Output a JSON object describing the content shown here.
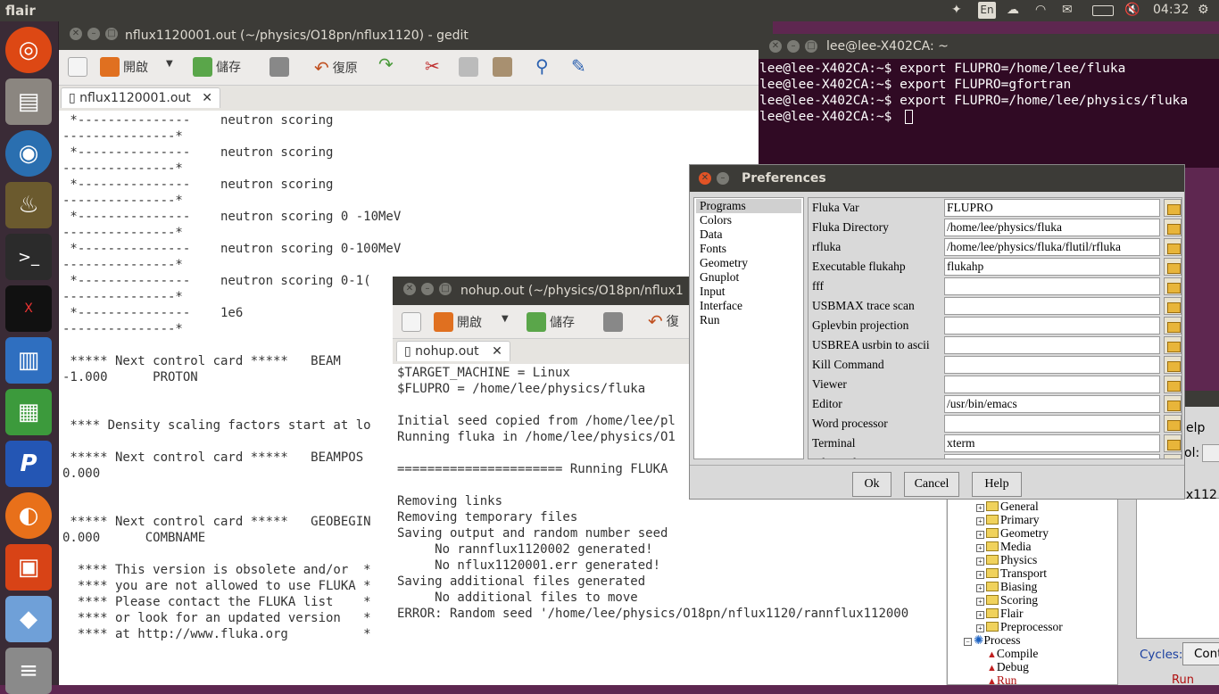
{
  "topbar": {
    "app_name": "flair",
    "lang": "En",
    "clock": "04:32"
  },
  "launcher": {
    "items": [
      "ubuntu-icon",
      "files-icon",
      "chromium-icon",
      "flair-icon",
      "terminal-icon",
      "xterm-icon",
      "writer-icon",
      "calc-icon",
      "p-app-icon",
      "firefox-icon",
      "installer-icon",
      "package-icon",
      "stack-icon"
    ]
  },
  "gedit1": {
    "title": "nflux1120001.out (~/physics/O18pn/nflux1120) - gedit",
    "toolbar": {
      "open": "開啟",
      "save": "儲存",
      "undo": "復原"
    },
    "tab": "nflux1120001.out",
    "lines": [
      " *---------------    neutron scoring",
      "---------------*",
      " *---------------    neutron scoring",
      "---------------*",
      " *---------------    neutron scoring",
      "---------------*",
      " *---------------    neutron scoring 0 -10MeV",
      "---------------*",
      " *---------------    neutron scoring 0-100MeV",
      "---------------*",
      " *---------------    neutron scoring 0-1(",
      "---------------*",
      " *---------------    1e6",
      "---------------*",
      "",
      " ***** Next control card *****   BEAM",
      "-1.000      PROTON",
      "",
      "",
      " **** Density scaling factors start at lo",
      "",
      " ***** Next control card *****   BEAMPOS",
      "0.000",
      "",
      "",
      " ***** Next control card *****   GEOBEGIN",
      "0.000      COMBNAME",
      "",
      "  **** This version is obsolete and/or  *",
      "  **** you are not allowed to use FLUKA *",
      "  **** Please contact the FLUKA list    *",
      "  **** or look for an updated version   *",
      "  **** at http://www.fluka.org          *"
    ]
  },
  "terminal": {
    "title": "lee@lee-X402CA: ~",
    "lines": [
      "lee@lee-X402CA:~$ export FLUPRO=/home/lee/fluka",
      "lee@lee-X402CA:~$ export FLUPRO=gfortran",
      "lee@lee-X402CA:~$ export FLUPRO=/home/lee/physics/fluka",
      "lee@lee-X402CA:~$ "
    ]
  },
  "gedit2": {
    "title": "nohup.out (~/physics/O18pn/nflux1",
    "toolbar": {
      "open": "開啟",
      "save": "儲存",
      "undo": "復"
    },
    "tab": "nohup.out",
    "lines": [
      "$TARGET_MACHINE = Linux",
      "$FLUPRO = /home/lee/physics/fluka",
      "",
      "Initial seed copied from /home/lee/pl",
      "Running fluka in /home/lee/physics/O1",
      "",
      "====================== Running FLUKA",
      "",
      "Removing links",
      "Removing temporary files",
      "Saving output and random number seed",
      "     No rannflux1120002 generated!",
      "     No nflux1120001.err generated!",
      "Saving additional files generated",
      "     No additional files to move",
      "ERROR: Random seed '/home/lee/physics/O18pn/nflux1120/rannflux112000"
    ]
  },
  "prefs": {
    "title": "Preferences",
    "categories": [
      "Programs",
      "Colors",
      "Data",
      "Fonts",
      "Geometry",
      "Gnuplot",
      "Input",
      "Interface",
      "Run"
    ],
    "rows": [
      {
        "label": "Fluka Var",
        "value": "FLUPRO"
      },
      {
        "label": "Fluka Directory",
        "value": "/home/lee/physics/fluka"
      },
      {
        "label": "rfluka",
        "value": "/home/lee/physics/fluka/flutil/rfluka"
      },
      {
        "label": "Executable flukahp",
        "value": "flukahp"
      },
      {
        "label": "fff",
        "value": ""
      },
      {
        "label": "USBMAX trace scan",
        "value": ""
      },
      {
        "label": "Gplevbin projection",
        "value": ""
      },
      {
        "label": "USBREA usrbin to ascii",
        "value": ""
      },
      {
        "label": "Kill Command",
        "value": ""
      },
      {
        "label": "Viewer",
        "value": ""
      },
      {
        "label": "Editor",
        "value": "/usr/bin/emacs"
      },
      {
        "label": "Word processor",
        "value": ""
      },
      {
        "label": "Terminal",
        "value": "xterm"
      },
      {
        "label": "File Explorer",
        "value": ""
      }
    ],
    "buttons": {
      "ok": "Ok",
      "cancel": "Cancel",
      "help": "Help"
    }
  },
  "flair": {
    "tree": [
      {
        "label": "General",
        "type": "folder"
      },
      {
        "label": "Primary",
        "type": "folder"
      },
      {
        "label": "Geometry",
        "type": "folder"
      },
      {
        "label": "Media",
        "type": "folder"
      },
      {
        "label": "Physics",
        "type": "folder"
      },
      {
        "label": "Transport",
        "type": "folder"
      },
      {
        "label": "Biasing",
        "type": "folder"
      },
      {
        "label": "Scoring",
        "type": "folder"
      },
      {
        "label": "Flair",
        "type": "folder"
      },
      {
        "label": "Preprocessor",
        "type": "folder"
      },
      {
        "label": "Process",
        "type": "process"
      },
      {
        "label": "Compile",
        "type": "item"
      },
      {
        "label": "Debug",
        "type": "item"
      },
      {
        "label": "Run",
        "type": "item"
      }
    ],
    "right": {
      "help_fragment": "elp",
      "tool_fragment": "ol:",
      "file_fragment": "ux112",
      "cycles_label": "Cycles:",
      "cont_button": "Cont",
      "run_fragment": "Run"
    }
  }
}
